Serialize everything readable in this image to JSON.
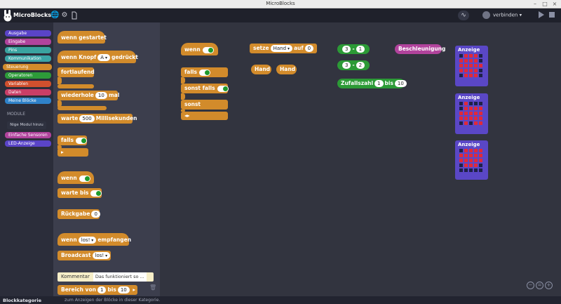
{
  "window": {
    "title": "MicroBlocks"
  },
  "app": {
    "name": "MicroBlocks",
    "connect_label": "verbinden"
  },
  "categories": [
    {
      "label": "Ausgabe",
      "color": "#5a44c8"
    },
    {
      "label": "Eingabe",
      "color": "#b1439c"
    },
    {
      "label": "Pins",
      "color": "#3aa3a0"
    },
    {
      "label": "Kommunikation",
      "color": "#3ba5a7"
    },
    {
      "label": "Steuerung",
      "color": "#d28b2b"
    },
    {
      "label": "Operatoren",
      "color": "#2d9b39"
    },
    {
      "label": "Variablen",
      "color": "#d0502e"
    },
    {
      "label": "Daten",
      "color": "#c93e66"
    },
    {
      "label": "Meine Blöcke",
      "color": "#2f82c9"
    }
  ],
  "modules": {
    "header": "MODULE",
    "add_button": "Nige Modul hinzu",
    "items": [
      {
        "label": "Einfache Sensoren",
        "color": "#b1439c"
      },
      {
        "label": "LED-Anzeige",
        "color": "#5a44c8"
      }
    ]
  },
  "palette": {
    "when_started": "wenn gestartet",
    "when_button_prefix": "wenn Knopf",
    "when_button_value": "A",
    "when_button_suffix": "gedrückt",
    "forever": "fortlaufend",
    "repeat_prefix": "wiederhole",
    "repeat_value": "10",
    "repeat_suffix": "mal",
    "wait_prefix": "warte",
    "wait_value": "500",
    "wait_suffix": "Millisekunden",
    "if": "falls",
    "when": "wenn",
    "wait_until": "warte bis",
    "return_prefix": "Rückgabe",
    "return_value": "0",
    "when_receive_prefix": "wenn",
    "when_receive_value": "los!",
    "when_receive_suffix": "empfangen",
    "broadcast_prefix": "Broadcast",
    "broadcast_value": "los!",
    "comment_label": "Kommentar",
    "comment_text": "Das funktioniert so ...",
    "range_prefix": "Bereich von",
    "range_from": "1",
    "range_mid": "bis",
    "range_to": "10"
  },
  "script": {
    "when": "wenn",
    "if": "falls",
    "else_if": "sonst falls",
    "else": "sonst",
    "set_prefix": "setze",
    "set_var": "Hand",
    "set_mid": "auf",
    "set_value": "0",
    "var_1": "Hand",
    "var_2": "Hand",
    "expr1_a": "3",
    "expr1_op": "-",
    "expr1_b": "1",
    "expr2_a": "3",
    "expr2_op": "-",
    "expr2_b": "2",
    "random_prefix": "Zufallszahl",
    "random_from": "1",
    "random_mid": "bis",
    "random_to": "10",
    "accel": "Beschleunigung",
    "display_label": "Anzeige"
  },
  "displays": [
    [
      0,
      1,
      1,
      1,
      0,
      1,
      1,
      1,
      1,
      0,
      1,
      1,
      1,
      1,
      1,
      1,
      1,
      1,
      1,
      0,
      0,
      1,
      1,
      1,
      0,
      0,
      1,
      1,
      1,
      0,
      1,
      1,
      1,
      1,
      1
    ],
    [
      0,
      1,
      0,
      0,
      0,
      0,
      1,
      1,
      1,
      1,
      1,
      1,
      1,
      1,
      1,
      1,
      1,
      1,
      1,
      1,
      0,
      1,
      0,
      1,
      1,
      0,
      1,
      0,
      1,
      1
    ],
    [
      0,
      1,
      1,
      1,
      1,
      1,
      1,
      1,
      1,
      1,
      1,
      1,
      1,
      1,
      1,
      0,
      1,
      1,
      1,
      0
    ]
  ],
  "status": {
    "category": "Blockkategorie",
    "hint": "zum Anzeigen der Blöcke in dieser Kategorie."
  }
}
